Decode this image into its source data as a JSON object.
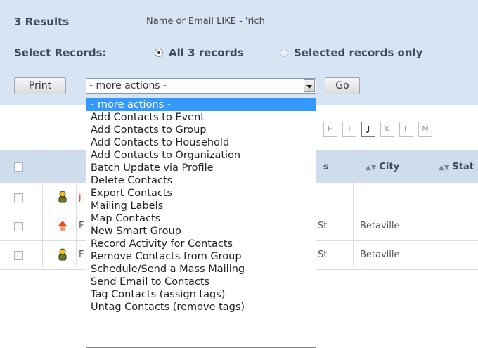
{
  "header": {
    "results_count": "3 Results",
    "criteria": "Name or Email LIKE - 'rich'"
  },
  "select_records": {
    "label": "Select Records:",
    "option_all": "All 3 records",
    "option_selected": "Selected records only",
    "checked": "all"
  },
  "actions": {
    "print_label": "Print",
    "select_value": "- more actions -",
    "go_label": "Go",
    "options": [
      "- more actions -",
      "Add Contacts to Event",
      "Add Contacts to Group",
      "Add Contacts to Household",
      "Add Contacts to Organization",
      "Batch Update via Profile",
      "Delete Contacts",
      "Export Contacts",
      "Mailing Labels",
      "Map Contacts",
      "New Smart Group",
      "Record Activity for Contacts",
      "Remove Contacts from Group",
      "Schedule/Send a Mass Mailing",
      "Send Email to Contacts",
      "Tag Contacts (assign tags)",
      "Untag Contacts (remove tags)"
    ]
  },
  "alphabet": [
    "H",
    "I",
    "J",
    "K",
    "L",
    "M"
  ],
  "alphabet_active": "J",
  "table": {
    "columns": [
      "s",
      "City",
      "Stat"
    ],
    "rows": [
      {
        "prefix": "j",
        "street": "",
        "city": "",
        "icon": "contact-icon"
      },
      {
        "prefix": "F",
        "street": "St",
        "city": "Betaville",
        "icon": "house-icon"
      },
      {
        "prefix": "F",
        "street": "St",
        "city": "Betaville",
        "icon": "contact-icon"
      }
    ]
  },
  "colors": {
    "panel_bg": "#d7e4f4",
    "header_bg": "#cfdcec",
    "highlight": "#3399ff"
  }
}
